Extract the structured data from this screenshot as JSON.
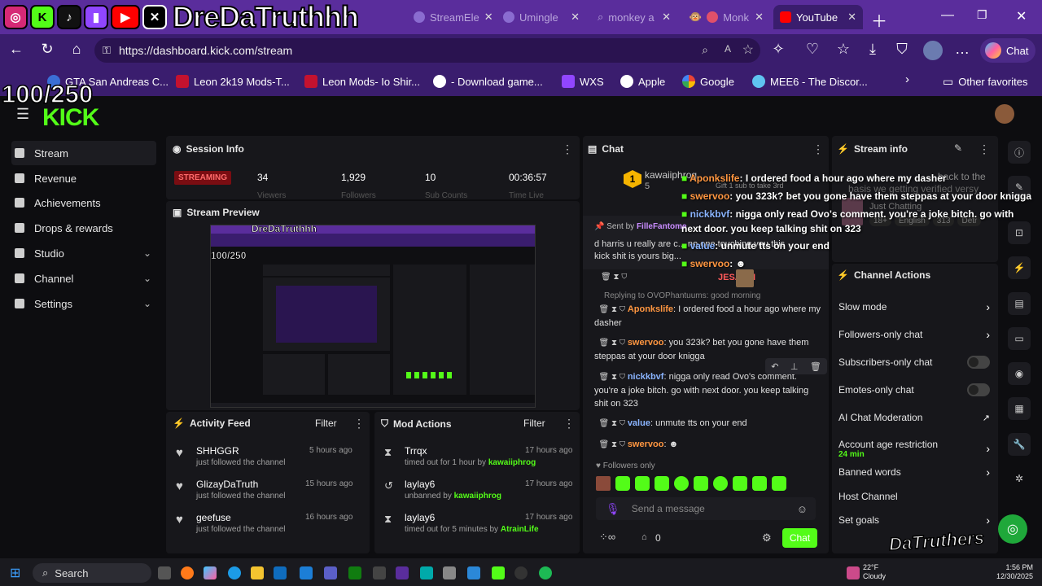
{
  "overlay": {
    "streamer": "DreDaTruthhh",
    "goal": "100/250",
    "social_icons": [
      "instagram-icon",
      "kick-icon",
      "tiktok-icon",
      "twitch-icon",
      "youtube-icon",
      "x-icon"
    ],
    "brand_logo": "DaTruthers"
  },
  "browser": {
    "tabs": [
      {
        "label": "StreamEle",
        "icon": "streamelements-icon"
      },
      {
        "label": "Umingle",
        "icon": "chat-bubble-icon"
      },
      {
        "label": "monkey a",
        "icon": "search-icon"
      },
      {
        "label": "Monk",
        "icon": "monkey-icon"
      },
      {
        "label": "YouTube",
        "icon": "youtube-icon"
      }
    ],
    "url": "https://dashboard.kick.com/stream",
    "copilot_label": "Chat",
    "favorites": [
      "GTA San Andreas C...",
      "Leon 2k19 Mods-T...",
      "Leon Mods- Io Shir...",
      "- Download game...",
      "WXS",
      "Apple",
      "Google",
      "MEE6 - The Discor..."
    ],
    "other_favorites": "Other favorites"
  },
  "sidebar": {
    "logo": "KICK",
    "items": [
      {
        "label": "Stream"
      },
      {
        "label": "Revenue"
      },
      {
        "label": "Achievements"
      },
      {
        "label": "Drops & rewards"
      },
      {
        "label": "Studio"
      },
      {
        "label": "Channel"
      },
      {
        "label": "Settings"
      }
    ]
  },
  "session_info": {
    "title": "Session Info",
    "badge": "STREAMING",
    "stats": [
      {
        "value": "34",
        "label": "Viewers"
      },
      {
        "value": "1,929",
        "label": "Followers"
      },
      {
        "value": "10",
        "label": "Sub Counts"
      },
      {
        "value": "00:36:57",
        "label": "Time Live"
      }
    ]
  },
  "stream_preview": {
    "title": "Stream Preview"
  },
  "activity_feed": {
    "title": "Activity Feed",
    "filter": "Filter",
    "items": [
      {
        "name": "SHHGGR",
        "sub": "just followed the channel",
        "time": "5 hours ago"
      },
      {
        "name": "GlizayDaTruth",
        "sub": "just followed the channel",
        "time": "15 hours ago"
      },
      {
        "name": "geefuse",
        "sub": "just followed the channel",
        "time": "16 hours ago"
      }
    ]
  },
  "mod_actions": {
    "title": "Mod Actions",
    "filter": "Filter",
    "items": [
      {
        "name": "Trrqx",
        "pre": "timed out for 1 hour by ",
        "by": "kawaiiphrog",
        "time": "17 hours ago"
      },
      {
        "name": "laylay6",
        "pre": "unbanned by ",
        "by": "kawaiiphrog",
        "time": "17 hours ago"
      },
      {
        "name": "laylay6",
        "pre": "timed out for 5 minutes by ",
        "by": "AtrainLife",
        "time": "17 hours ago"
      }
    ]
  },
  "chat": {
    "title": "Chat",
    "pinned_user": "kawaiiphrog",
    "pinned_count": "5",
    "pinned_sub": "Gift 1 sub to take 3rd",
    "sent_by_label": "Sent by",
    "sent_by": "FilleFantome",
    "pinned_msg": "d harris u really are c... no one touching you this kick shit is yours big...",
    "reply_to": "Replying to OVOPhantuums: good morning",
    "messages": [
      {
        "user": "JESAYIN",
        "text": ""
      },
      {
        "user": "Aponkslife",
        "text": "I ordered food a hour ago where my dasher"
      },
      {
        "user": "swervoo",
        "text": "you 323k? bet you gone have them steppas at your door knigga"
      },
      {
        "user": "nickkbvf",
        "text": "nigga only read Ovo's comment. you're a joke bitch. go with next door. you keep talking shit on 323"
      },
      {
        "user": "value",
        "text": "unmute tts on your end"
      },
      {
        "user": "swervoo",
        "text": ""
      }
    ],
    "followers_only": "Followers only",
    "placeholder": "Send a message",
    "count": "0",
    "send": "Chat"
  },
  "overlay_chat": [
    {
      "user": "Aponkslife",
      "text": "I ordered food a hour ago where my dasher"
    },
    {
      "user": "swervoo",
      "text": "you 323k? bet you gone have them steppas at your door knigga"
    },
    {
      "user": "nickkbvf",
      "text": "nigga only read Ovo's comment. you're a joke bitch. go with next door. you keep talking shit on 323"
    },
    {
      "user": "value",
      "text": "unmute tts on your end"
    },
    {
      "user": "swervoo",
      "text": ""
    }
  ],
  "stream_info": {
    "title": "Stream info",
    "bg_text": "basis we getting verified versy",
    "bg_text2": "back to the",
    "category": "Just Chatting",
    "tags": [
      "18+",
      "English",
      "313",
      "Detr"
    ]
  },
  "channel_actions": {
    "title": "Channel Actions",
    "items": [
      {
        "label": "Slow mode",
        "type": "chevron"
      },
      {
        "label": "Followers-only chat",
        "type": "chevron"
      },
      {
        "label": "Subscribers-only chat",
        "type": "toggle"
      },
      {
        "label": "Emotes-only chat",
        "type": "toggle"
      },
      {
        "label": "AI Chat Moderation",
        "type": "external"
      },
      {
        "label": "Account age restriction",
        "sub": "24 min",
        "type": "chevron"
      },
      {
        "label": "Banned words",
        "type": "chevron"
      },
      {
        "label": "Host Channel",
        "type": "none"
      },
      {
        "label": "Set goals",
        "type": "chevron"
      }
    ]
  },
  "taskbar": {
    "search": "Search",
    "temp": "22°F",
    "weather": "Cloudy",
    "time": "1:56 PM",
    "date": "12/30/2025"
  }
}
